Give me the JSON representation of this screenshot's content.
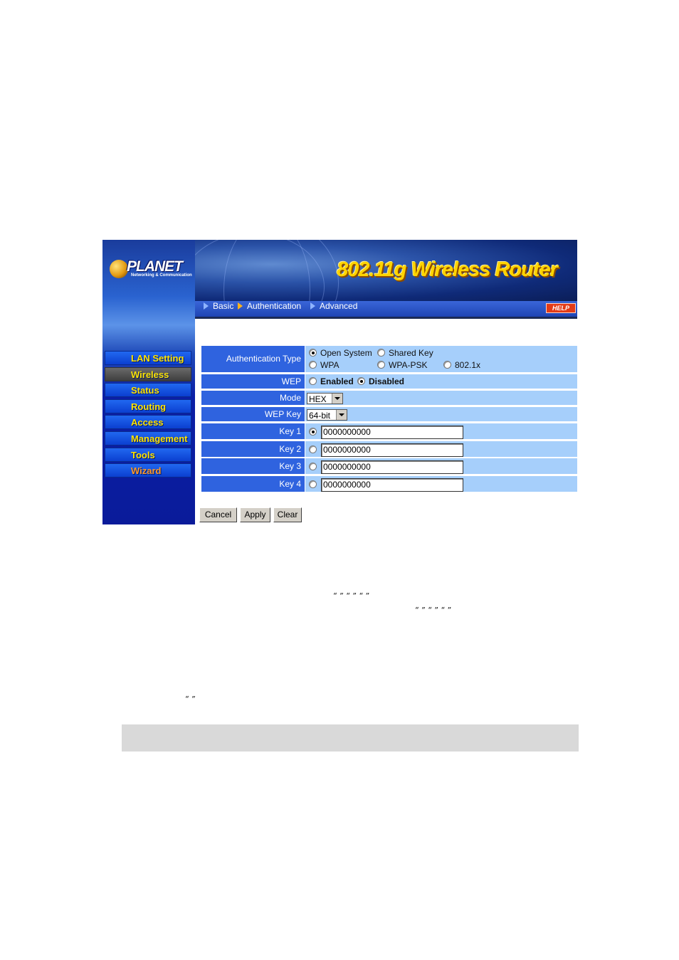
{
  "sidebar": {
    "logo": {
      "brand": "PLANET",
      "tagline": "Networking & Communication"
    },
    "menu": [
      "LAN Setting",
      "Wireless",
      "Status",
      "Routing",
      "Access",
      "Management",
      "Tools",
      "Wizard"
    ],
    "active": "Wireless"
  },
  "header": {
    "title": "802.11g Wireless Router"
  },
  "nav": {
    "items": [
      "Basic",
      "Authentication",
      "Advanced"
    ],
    "help": "HELP"
  },
  "form": {
    "auth_type": {
      "label": "Authentication Type",
      "options": [
        "Open System",
        "Shared Key",
        "WPA",
        "WPA-PSK",
        "802.1x"
      ],
      "selected": "Open System"
    },
    "wep": {
      "label": "WEP",
      "options": [
        "Enabled",
        "Disabled"
      ],
      "selected": "Disabled"
    },
    "mode": {
      "label": "Mode",
      "value": "HEX"
    },
    "wep_key": {
      "label": "WEP Key",
      "value": "64-bit"
    },
    "keys": [
      {
        "label": "Key 1",
        "value": "0000000000",
        "selected": true
      },
      {
        "label": "Key 2",
        "value": "0000000000",
        "selected": false
      },
      {
        "label": "Key 3",
        "value": "0000000000",
        "selected": false
      },
      {
        "label": "Key 4",
        "value": "0000000000",
        "selected": false
      }
    ]
  },
  "buttons": {
    "cancel": "Cancel",
    "apply": "Apply",
    "clear": "Clear"
  },
  "colors": {
    "label_bg": "#2f63df",
    "value_bg": "#a6cffb",
    "menu_text": "#ffe400",
    "title": "#ffd400"
  },
  "quotes": {
    "line1": "“   ” “  ”      “  ”",
    "line2": "“  ” “   ”      “  ”",
    "line3": "“    ”"
  }
}
